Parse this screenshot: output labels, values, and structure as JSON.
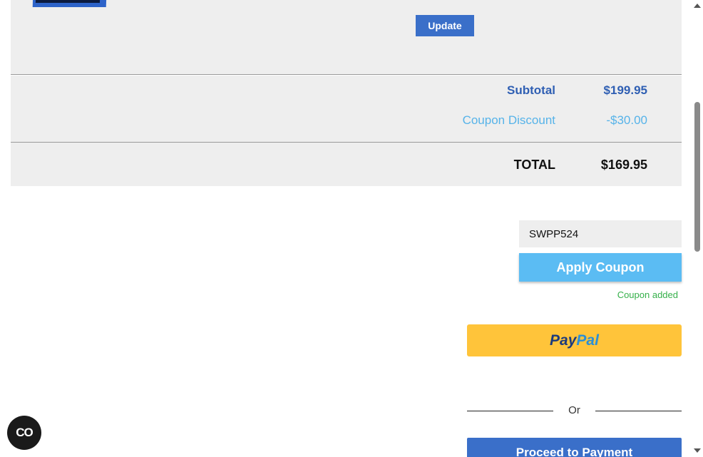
{
  "cart_item": {
    "update_label": "Update"
  },
  "totals": {
    "subtotal_label": "Subtotal",
    "subtotal_value": "$199.95",
    "discount_label": "Coupon Discount",
    "discount_value": "-$30.00",
    "total_label": "TOTAL",
    "total_value": "$169.95"
  },
  "coupon": {
    "code_value": "SWPP524",
    "apply_label": "Apply Coupon",
    "status_text": "Coupon added"
  },
  "paypal": {
    "label_part1": "Pay",
    "label_part2": "Pal"
  },
  "divider": {
    "or_text": "Or"
  },
  "checkout": {
    "proceed_label": "Proceed to Payment"
  },
  "chat": {
    "badge_text": "CO"
  },
  "colors": {
    "accent_blue": "#3a6fc9",
    "coupon_blue": "#5bbcf3",
    "paypal_yellow": "#ffc43a",
    "success_green": "#35b04a",
    "panel_gray": "#eeeeee"
  },
  "icons": {
    "chat": "chat-bubble-icon",
    "scroll_up": "chevron-up-icon",
    "scroll_down": "chevron-down-icon"
  }
}
